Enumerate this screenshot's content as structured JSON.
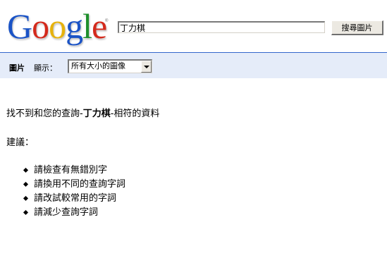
{
  "logo": {
    "letters": [
      {
        "char": "G",
        "color": "#1a53c6"
      },
      {
        "char": "o",
        "color": "#d42a1c"
      },
      {
        "char": "o",
        "color": "#e6b20d"
      },
      {
        "char": "g",
        "color": "#1a53c6"
      },
      {
        "char": "l",
        "color": "#1f8f2c"
      },
      {
        "char": "e",
        "color": "#d42a1c"
      }
    ],
    "registered": "®"
  },
  "search": {
    "query": "丁力棋",
    "button_label": "搜尋圖片"
  },
  "toolbar": {
    "title": "圖片",
    "show_label": "顯示：",
    "size_select_value": "所有大小的圖像",
    "bar_color": "#e5ecf9",
    "border_color": "#3366cc"
  },
  "results": {
    "not_found_prefix": "找不到和您的查詢-",
    "query_bold": "丁力棋",
    "not_found_suffix": "-相符的資料",
    "suggestions_label": "建議：",
    "suggestions": [
      "請檢查有無錯別字",
      "請換用不同的查詢字詞",
      "請改試較常用的字詞",
      "請減少查詢字詞"
    ]
  }
}
